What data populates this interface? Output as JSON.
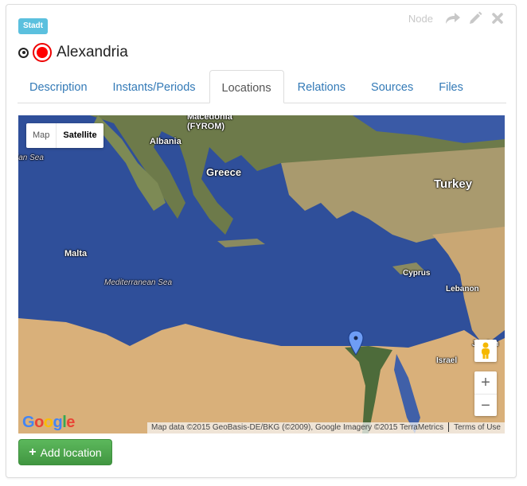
{
  "header": {
    "badge": "Stadt",
    "title": "Alexandria",
    "node_label": "Node",
    "icons": [
      "share-icon",
      "pencil-icon",
      "close-icon"
    ]
  },
  "tabs": [
    {
      "label": "Description",
      "active": false
    },
    {
      "label": "Instants/Periods",
      "active": false
    },
    {
      "label": "Locations",
      "active": true
    },
    {
      "label": "Relations",
      "active": false
    },
    {
      "label": "Sources",
      "active": false
    },
    {
      "label": "Files",
      "active": false
    }
  ],
  "map": {
    "type_options": {
      "map": "Map",
      "satellite": "Satellite"
    },
    "selected_type": "Satellite",
    "labels": {
      "macedonia": "Macedonia",
      "fyrom": "(FYROM)",
      "albania": "Albania",
      "ionian_sea": "ian Sea",
      "greece": "Greece",
      "turkey": "Turkey",
      "malta": "Malta",
      "mediterranean": "Mediterranean Sea",
      "cyprus": "Cyprus",
      "lebanon": "Lebanon",
      "israel": "Israel",
      "jordan": "Jordan"
    },
    "zoom_in": "+",
    "zoom_out": "−",
    "logo": "Google",
    "attribution": "Map data ©2015 GeoBasis-DE/BKG (©2009), Google Imagery ©2015 TerraMetrics",
    "terms": "Terms of Use",
    "colors": {
      "sea": "#2f4f9a",
      "desert": "#d9b07a",
      "land": "#6d7a4a"
    }
  },
  "actions": {
    "add_location": "Add location",
    "add_color": "#4cae4c"
  }
}
